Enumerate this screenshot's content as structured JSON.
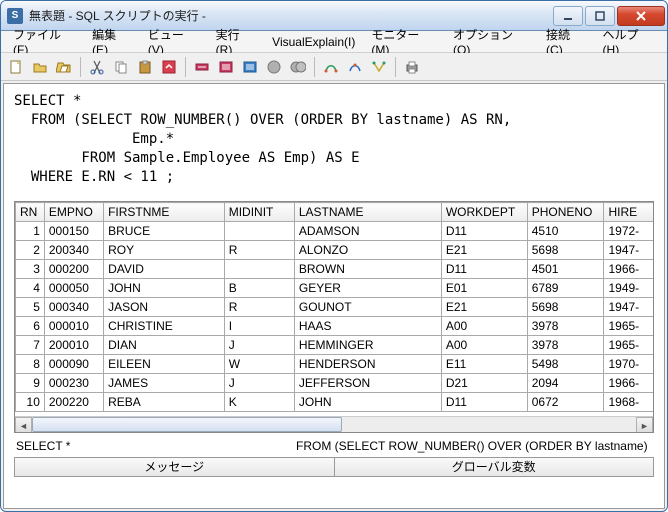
{
  "window": {
    "title": "無表題 - SQL スクリプトの実行 - ",
    "icon_label": "S"
  },
  "menus": [
    "ファイル(F)",
    "編集(E)",
    "ビュー(V)",
    "実行(R)",
    "VisualExplain(I)",
    "モニター(M)",
    "オプション(O)",
    "接続(C)",
    "ヘルプ(H)"
  ],
  "toolbar_icons": [
    "new-icon",
    "open-icon",
    "save-icon",
    "cut-icon",
    "copy-icon",
    "paste-icon",
    "undo-icon",
    "run-step-icon",
    "run-icon",
    "run-selection-icon",
    "stop-icon",
    "stop-all-icon",
    "plan-a-icon",
    "plan-b-icon",
    "plan-c-icon",
    "print-icon"
  ],
  "sql": "SELECT *\n  FROM (SELECT ROW_NUMBER() OVER (ORDER BY lastname) AS RN,\n              Emp.*\n        FROM Sample.Employee AS Emp) AS E\n  WHERE E.RN < 11 ;",
  "columns": [
    "RN",
    "EMPNO",
    "FIRSTNME",
    "MIDINIT",
    "LASTNAME",
    "WORKDEPT",
    "PHONENO",
    "HIRE"
  ],
  "rows": [
    {
      "rn": 1,
      "empno": "000150",
      "first": "BRUCE",
      "mid": "",
      "last": "ADAMSON",
      "dept": "D11",
      "phone": "4510",
      "hire": "1972-"
    },
    {
      "rn": 2,
      "empno": "200340",
      "first": "ROY",
      "mid": "R",
      "last": "ALONZO",
      "dept": "E21",
      "phone": "5698",
      "hire": "1947-"
    },
    {
      "rn": 3,
      "empno": "000200",
      "first": "DAVID",
      "mid": "",
      "last": "BROWN",
      "dept": "D11",
      "phone": "4501",
      "hire": "1966-"
    },
    {
      "rn": 4,
      "empno": "000050",
      "first": "JOHN",
      "mid": "B",
      "last": "GEYER",
      "dept": "E01",
      "phone": "6789",
      "hire": "1949-"
    },
    {
      "rn": 5,
      "empno": "000340",
      "first": "JASON",
      "mid": "R",
      "last": "GOUNOT",
      "dept": "E21",
      "phone": "5698",
      "hire": "1947-"
    },
    {
      "rn": 6,
      "empno": "000010",
      "first": "CHRISTINE",
      "mid": "I",
      "last": "HAAS",
      "dept": "A00",
      "phone": "3978",
      "hire": "1965-"
    },
    {
      "rn": 7,
      "empno": "200010",
      "first": "DIAN",
      "mid": "J",
      "last": "HEMMINGER",
      "dept": "A00",
      "phone": "3978",
      "hire": "1965-"
    },
    {
      "rn": 8,
      "empno": "000090",
      "first": "EILEEN",
      "mid": "W",
      "last": "HENDERSON",
      "dept": "E11",
      "phone": "5498",
      "hire": "1970-"
    },
    {
      "rn": 9,
      "empno": "000230",
      "first": "JAMES",
      "mid": "J",
      "last": "JEFFERSON",
      "dept": "D21",
      "phone": "2094",
      "hire": "1966-"
    },
    {
      "rn": 10,
      "empno": "200220",
      "first": "REBA",
      "mid": "K",
      "last": "JOHN",
      "dept": "D11",
      "phone": "0672",
      "hire": "1968-"
    }
  ],
  "status": {
    "left": "SELECT *",
    "right": "FROM (SELECT ROW_NUMBER() OVER (ORDER BY lastname)"
  },
  "tabs": {
    "messages": "メッセージ",
    "globals": "グローバル変数"
  }
}
